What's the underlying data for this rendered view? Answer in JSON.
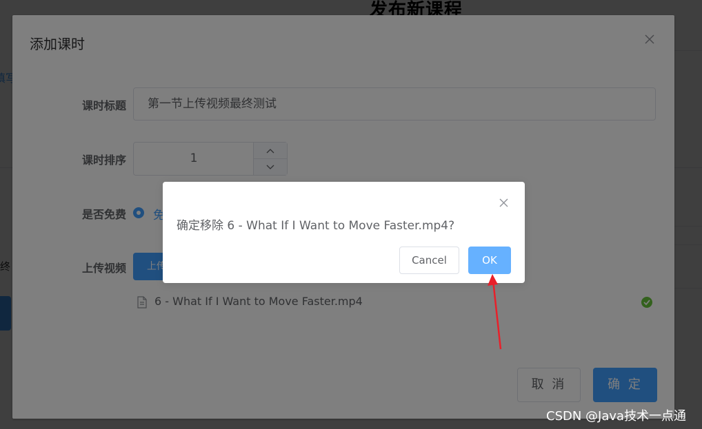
{
  "background": {
    "page_title": "发布新课程",
    "left_link_fragment": "填写",
    "left_text_fragment": "终"
  },
  "dialog": {
    "title": "添加课时",
    "close_icon": "close-icon",
    "form": {
      "lesson_title_label": "课时标题",
      "lesson_title_value": "第一节上传视频最终测试",
      "lesson_order_label": "课时排序",
      "lesson_order_value": "1",
      "is_free_label": "是否免费",
      "is_free_selected": "免",
      "upload_video_label": "上传视频",
      "upload_button_label": "上传"
    },
    "uploaded_file": {
      "name": "6 - What If I Want to Move Faster.mp4",
      "status_icon": "check-circle-icon"
    },
    "footer": {
      "cancel_label": "取 消",
      "confirm_label": "确 定"
    }
  },
  "confirm_box": {
    "message": "确定移除 6 - What If I Want to Move Faster.mp4?",
    "cancel_label": "Cancel",
    "ok_label": "OK",
    "close_icon": "close-icon"
  },
  "watermark": "CSDN @Java技术一点通",
  "colors": {
    "primary": "#409eff",
    "primary_light": "#66b1ff",
    "success": "#67c23a",
    "annotation_arrow": "#e8202a"
  }
}
